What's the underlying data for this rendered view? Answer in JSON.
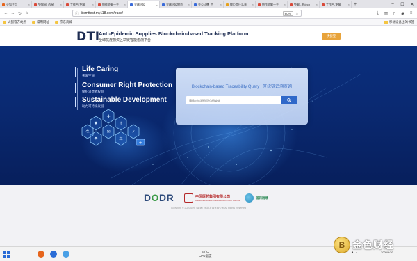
{
  "browser": {
    "tabs": [
      {
        "label": "火狐主页",
        "color": "#e6651c",
        "active": false
      },
      {
        "label": "免解网_西鼠",
        "color": "#d94a3a",
        "active": false
      },
      {
        "label": "工作台-免解",
        "color": "#d94a3a",
        "active": false
      },
      {
        "label": "帕作免解一手",
        "color": "#d94a3a",
        "active": false
      },
      {
        "label": "全球抗疫",
        "color": "#3a6bd9",
        "active": true
      },
      {
        "label": "全球抗疫物资",
        "color": "#3a6bd9",
        "active": false
      },
      {
        "label": "金公印撒_西",
        "color": "#3a6bd9",
        "active": false
      },
      {
        "label": "鲸巨是什么意",
        "color": "#e6a11c",
        "active": false
      },
      {
        "label": "帕作免解一手",
        "color": "#d94a3a",
        "active": false
      },
      {
        "label": "免解 - 鸡tech",
        "color": "#d94a3a",
        "active": false
      },
      {
        "label": "工作台-免解",
        "color": "#d94a3a",
        "active": false
      }
    ],
    "url": "tbcmttest.my118.com/trace/",
    "zoom": "80%",
    "bookmarks": [
      "火狐官方站点",
      "常用网址",
      "京东商城"
    ],
    "bookmarks_right": "移动设备上的书签"
  },
  "site": {
    "logo": "DTI",
    "title_en": "Anti-Epidemic Supplies Blockchain-based Tracking Platform",
    "title_cn": "全球抗疫物资区块链智能追溯平台",
    "login_label": "快捷登"
  },
  "hero": {
    "taglines": [
      {
        "en": "Life Caring",
        "cn": "关爱生命"
      },
      {
        "en": "Consumer Right Protection",
        "cn": "保护消费者权益"
      },
      {
        "en": "Sustainable Development",
        "cn": "助力可持续发展"
      }
    ],
    "query": {
      "title": "Blockchain-based Traceability Query | 区块链追溯查询",
      "placeholder": "请输入追溯码/防伪码查询",
      "button_icon": "search-icon"
    }
  },
  "partners": {
    "dodr_d": "D",
    "dodr_o": "O",
    "dodr_rest": "DR",
    "sinopharm_name": "中国医药集团有限公司",
    "sinopharm_sub": "CHINA NATIONAL PHARMACEUTICAL GROUP",
    "third_name": "国药跨境",
    "copyright": "Copyright © 2020国药（香港）科技发展有限公司 All Rights Reserved"
  },
  "taskbar": {
    "weather_temp": "42°C",
    "weather_label": "CPU温度",
    "time": "",
    "date": "2020/6/30"
  },
  "watermark": {
    "coin_glyph": "B",
    "text": "金色财经"
  },
  "colors": {
    "brand_navy": "#1e2d52",
    "accent_orange": "#e8a33a",
    "hero_blue": "#0a2f7e",
    "query_button": "#2f68c9"
  }
}
